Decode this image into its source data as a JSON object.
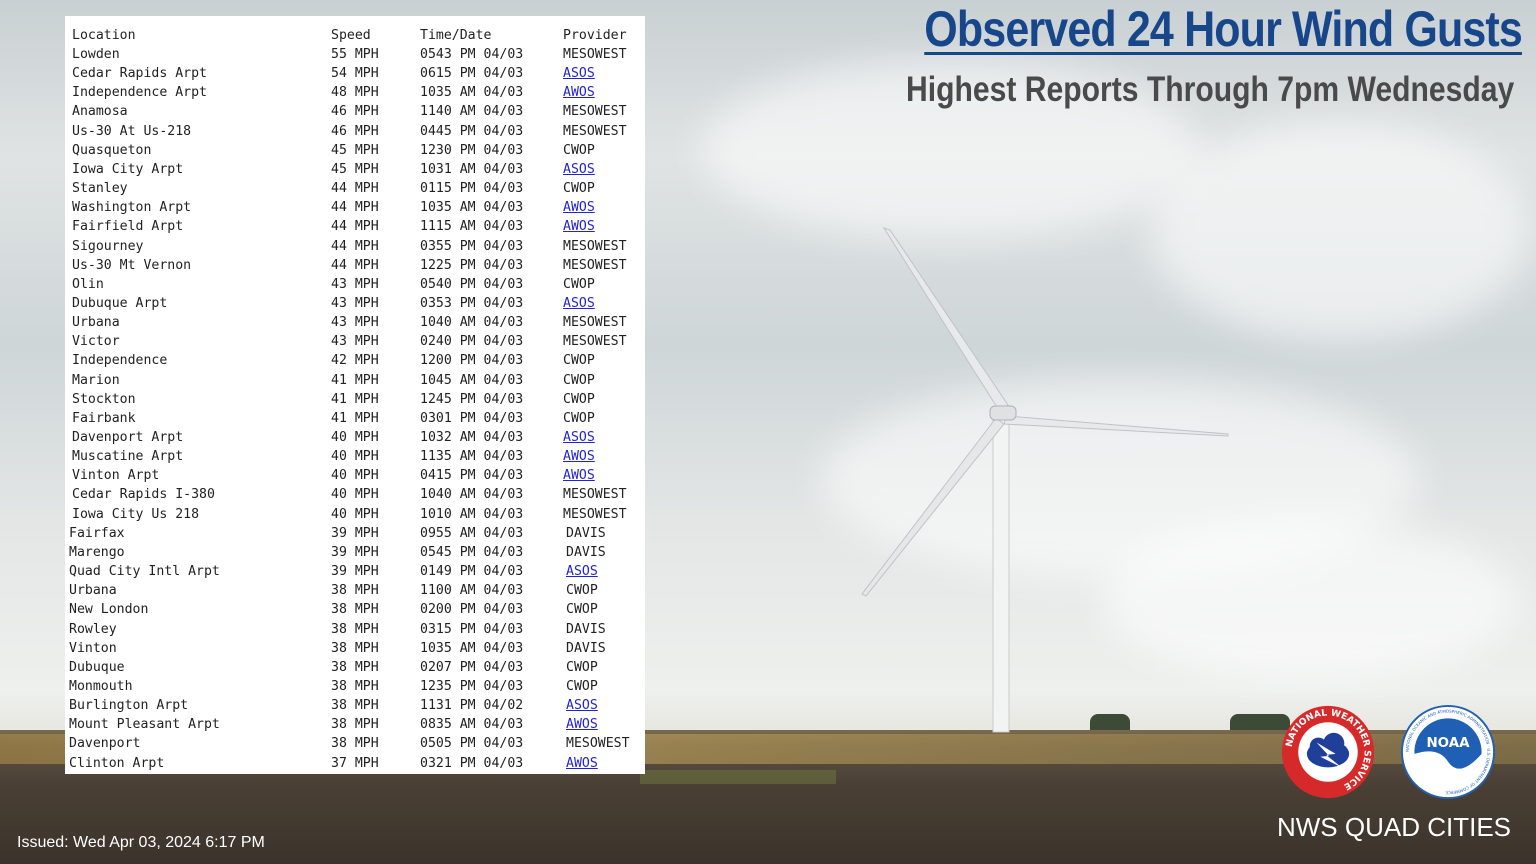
{
  "header": {
    "title": "Observed 24 Hour Wind Gusts",
    "subtitle": "Highest Reports Through 7pm Wednesday"
  },
  "table": {
    "columns": [
      "Location",
      "Speed",
      "Time/Date",
      "Provider"
    ],
    "rows": [
      {
        "location": "Lowden",
        "speed": "55 MPH",
        "time": "0543 PM 04/03",
        "provider": "MESOWEST",
        "link": false
      },
      {
        "location": "Cedar Rapids Arpt",
        "speed": "54 MPH",
        "time": "0615 PM 04/03",
        "provider": "ASOS",
        "link": true
      },
      {
        "location": "Independence Arpt",
        "speed": "48 MPH",
        "time": "1035 AM 04/03",
        "provider": "AWOS",
        "link": true
      },
      {
        "location": "Anamosa",
        "speed": "46 MPH",
        "time": "1140 AM 04/03",
        "provider": "MESOWEST",
        "link": false
      },
      {
        "location": "Us-30 At Us-218",
        "speed": "46 MPH",
        "time": "0445 PM 04/03",
        "provider": "MESOWEST",
        "link": false
      },
      {
        "location": "Quasqueton",
        "speed": "45 MPH",
        "time": "1230 PM 04/03",
        "provider": "CWOP",
        "link": false
      },
      {
        "location": "Iowa City Arpt",
        "speed": "45 MPH",
        "time": "1031 AM 04/03",
        "provider": "ASOS",
        "link": true
      },
      {
        "location": "Stanley",
        "speed": "44 MPH",
        "time": "0115 PM 04/03",
        "provider": "CWOP",
        "link": false
      },
      {
        "location": "Washington Arpt",
        "speed": "44 MPH",
        "time": "1035 AM 04/03",
        "provider": "AWOS",
        "link": true
      },
      {
        "location": "Fairfield Arpt",
        "speed": "44 MPH",
        "time": "1115 AM 04/03",
        "provider": "AWOS",
        "link": true
      },
      {
        "location": "Sigourney",
        "speed": "44 MPH",
        "time": "0355 PM 04/03",
        "provider": "MESOWEST",
        "link": false
      },
      {
        "location": "Us-30 Mt Vernon",
        "speed": "44 MPH",
        "time": "1225 PM 04/03",
        "provider": "MESOWEST",
        "link": false
      },
      {
        "location": "Olin",
        "speed": "43 MPH",
        "time": "0540 PM 04/03",
        "provider": "CWOP",
        "link": false
      },
      {
        "location": "Dubuque Arpt",
        "speed": "43 MPH",
        "time": "0353 PM 04/03",
        "provider": "ASOS",
        "link": true
      },
      {
        "location": "Urbana",
        "speed": "43 MPH",
        "time": "1040 AM 04/03",
        "provider": "MESOWEST",
        "link": false
      },
      {
        "location": "Victor",
        "speed": "43 MPH",
        "time": "0240 PM 04/03",
        "provider": "MESOWEST",
        "link": false
      },
      {
        "location": "Independence",
        "speed": "42 MPH",
        "time": "1200 PM 04/03",
        "provider": "CWOP",
        "link": false
      },
      {
        "location": "Marion",
        "speed": "41 MPH",
        "time": "1045 AM 04/03",
        "provider": "CWOP",
        "link": false
      },
      {
        "location": "Stockton",
        "speed": "41 MPH",
        "time": "1245 PM 04/03",
        "provider": "CWOP",
        "link": false
      },
      {
        "location": "Fairbank",
        "speed": "41 MPH",
        "time": "0301 PM 04/03",
        "provider": "CWOP",
        "link": false
      },
      {
        "location": "Davenport Arpt",
        "speed": "40 MPH",
        "time": "1032 AM 04/03",
        "provider": "ASOS",
        "link": true
      },
      {
        "location": "Muscatine Arpt",
        "speed": "40 MPH",
        "time": "1135 AM 04/03",
        "provider": "AWOS",
        "link": true
      },
      {
        "location": "Vinton Arpt",
        "speed": "40 MPH",
        "time": "0415 PM 04/03",
        "provider": "AWOS",
        "link": true
      },
      {
        "location": "Cedar Rapids I-380",
        "speed": "40 MPH",
        "time": "1040 AM 04/03",
        "provider": "MESOWEST",
        "link": false
      },
      {
        "location": "Iowa City Us 218",
        "speed": "40 MPH",
        "time": "1010 AM 04/03",
        "provider": "MESOWEST",
        "link": false
      },
      {
        "location": "Fairfax",
        "speed": "39 MPH",
        "time": "0955 AM 04/03",
        "provider": "DAVIS",
        "link": false
      },
      {
        "location": "Marengo",
        "speed": "39 MPH",
        "time": "0545 PM 04/03",
        "provider": "DAVIS",
        "link": false
      },
      {
        "location": "Quad City Intl Arpt",
        "speed": "39 MPH",
        "time": "0149 PM 04/03",
        "provider": "ASOS",
        "link": true
      },
      {
        "location": "Urbana",
        "speed": "38 MPH",
        "time": "1100 AM 04/03",
        "provider": "CWOP",
        "link": false
      },
      {
        "location": "New London",
        "speed": "38 MPH",
        "time": "0200 PM 04/03",
        "provider": "CWOP",
        "link": false
      },
      {
        "location": "Rowley",
        "speed": "38 MPH",
        "time": "0315 PM 04/03",
        "provider": "DAVIS",
        "link": false
      },
      {
        "location": "Vinton",
        "speed": "38 MPH",
        "time": "1035 AM 04/03",
        "provider": "DAVIS",
        "link": false
      },
      {
        "location": "Dubuque",
        "speed": "38 MPH",
        "time": "0207 PM 04/03",
        "provider": "CWOP",
        "link": false
      },
      {
        "location": "Monmouth",
        "speed": "38 MPH",
        "time": "1235 PM 04/03",
        "provider": "CWOP",
        "link": false
      },
      {
        "location": "Burlington Arpt",
        "speed": "38 MPH",
        "time": "1131 PM 04/02",
        "provider": "ASOS",
        "link": true
      },
      {
        "location": "Mount Pleasant Arpt",
        "speed": "38 MPH",
        "time": "0835 AM 04/03",
        "provider": "AWOS",
        "link": true
      },
      {
        "location": "Davenport",
        "speed": "38 MPH",
        "time": "0505 PM 04/03",
        "provider": "MESOWEST",
        "link": false
      },
      {
        "location": "Clinton Arpt",
        "speed": "37 MPH",
        "time": "0321 PM 04/03",
        "provider": "AWOS",
        "link": true
      }
    ]
  },
  "footer": {
    "issued": "Issued: Wed Apr 03, 2024 6:17 PM",
    "office": "NWS QUAD CITIES"
  },
  "logos": {
    "nws_text": "NATIONAL WEATHER SERVICE",
    "noaa_text": "NOAA",
    "noaa_ring_text": "NATIONAL OCEANIC AND ATMOSPHERIC ADMINISTRATION · U.S. DEPARTMENT OF COMMERCE"
  },
  "colors": {
    "title": "#17468a",
    "subtitle": "#4a4a4a",
    "link": "#2323d6",
    "nws_red": "#d62a2a",
    "noaa_blue": "#1f5fb4"
  }
}
